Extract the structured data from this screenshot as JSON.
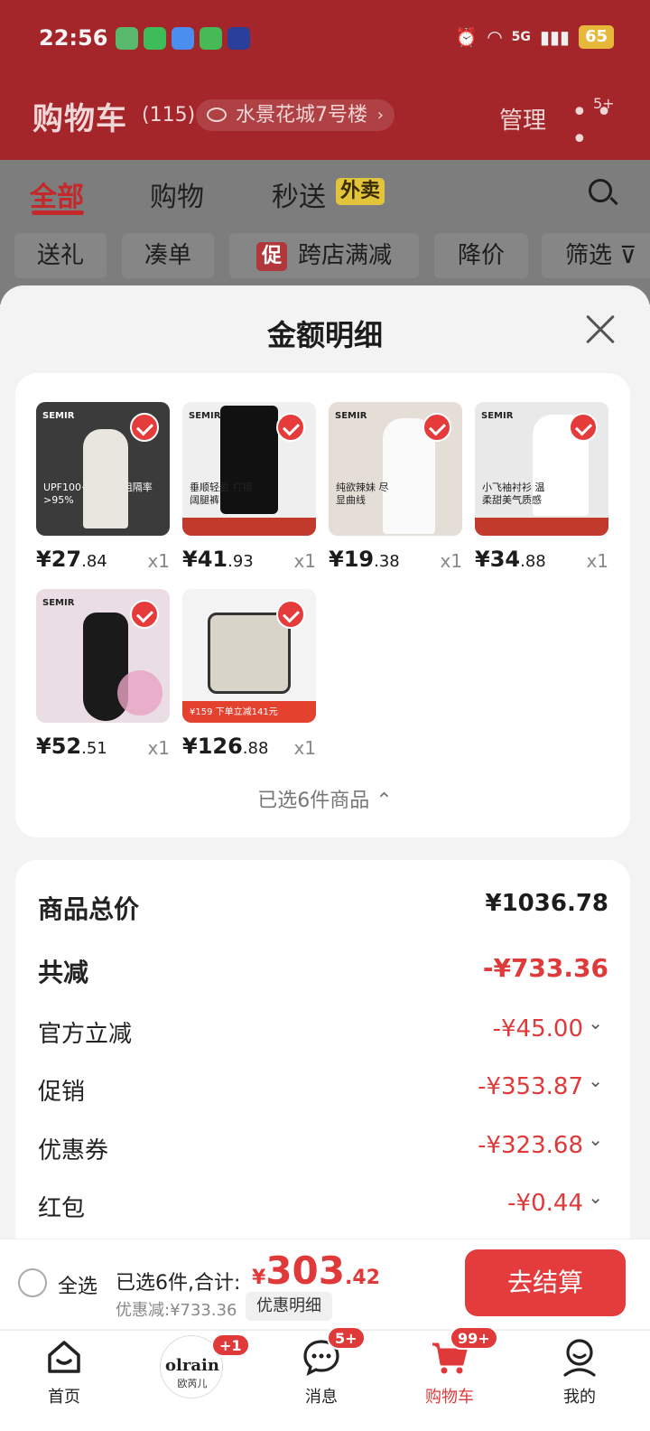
{
  "status": {
    "time": "22:56",
    "network": "5G",
    "battery": "65"
  },
  "header": {
    "title": "购物车",
    "count": "(115)",
    "address": "水景花城7号楼",
    "manage": "管理",
    "more_badge": "5+"
  },
  "tabs": [
    "全部",
    "购物",
    "秒送"
  ],
  "tab_badge": "外卖",
  "chips": [
    "送礼",
    "凑单",
    "跨店满减",
    "降价",
    "筛选"
  ],
  "chip_promo": "促",
  "sheet": {
    "title": "金额明细",
    "selected_summary": "已选6件商品 ⌃"
  },
  "products": [
    {
      "yuan": "¥27",
      "cents": ".84",
      "qty": "x1",
      "brand": "SEMIR",
      "text": "UPF100+ 紫外线阻隔率>95%",
      "color": "#3b3b3b"
    },
    {
      "yuan": "¥41",
      "cents": ".93",
      "qty": "x1",
      "brand": "SEMIR",
      "text": "垂顺轻盈 打褶阔腿裤",
      "color": "#efefef"
    },
    {
      "yuan": "¥19",
      "cents": ".38",
      "qty": "x1",
      "brand": "SEMIR",
      "text": "纯欲辣妹 尽显曲线",
      "color": "#e4ded6"
    },
    {
      "yuan": "¥34",
      "cents": ".88",
      "qty": "x1",
      "brand": "SEMIR",
      "text": "小飞袖衬衫 温柔甜美气质感",
      "color": "#e9e9e9"
    },
    {
      "yuan": "¥52",
      "cents": ".51",
      "qty": "x1",
      "brand": "SEMIR",
      "text": "",
      "color": "#eadde4"
    },
    {
      "yuan": "¥126",
      "cents": ".88",
      "qty": "x1",
      "brand": "",
      "text": "¥159 下单立减141元",
      "color": "#f3f3f3"
    }
  ],
  "breakdown": [
    {
      "label": "商品总价",
      "value": "¥1036.78",
      "big": true,
      "neutral": true
    },
    {
      "label": "共减",
      "value": "-¥733.36",
      "big": true,
      "neutral": false
    },
    {
      "label": "官方立减",
      "value": "-¥45.00",
      "big": false
    },
    {
      "label": "促销",
      "value": "-¥353.87",
      "big": false
    },
    {
      "label": "优惠券",
      "value": "-¥323.68",
      "big": false
    },
    {
      "label": "红包",
      "value": "-¥0.44",
      "big": false
    }
  ],
  "checkout": {
    "select_all": "全选",
    "summary": "已选6件,合计:",
    "total_symbol": "¥",
    "total_int": "303",
    "total_dec": ".42",
    "discount": "优惠减:¥733.36",
    "detail": "优惠明细",
    "pay": "去结算"
  },
  "nav": [
    {
      "label": "首页",
      "icon": "home-icon"
    },
    {
      "label": "欧芮儿",
      "icon": "olrain-logo",
      "badge": "+1"
    },
    {
      "label": "消息",
      "icon": "message-icon",
      "badge": "5+"
    },
    {
      "label": "购物车",
      "icon": "cart-icon",
      "badge": "99+"
    },
    {
      "label": "我的",
      "icon": "profile-icon"
    }
  ],
  "colors": {
    "brand_red": "#e0393a",
    "header_red": "#a4262a"
  }
}
